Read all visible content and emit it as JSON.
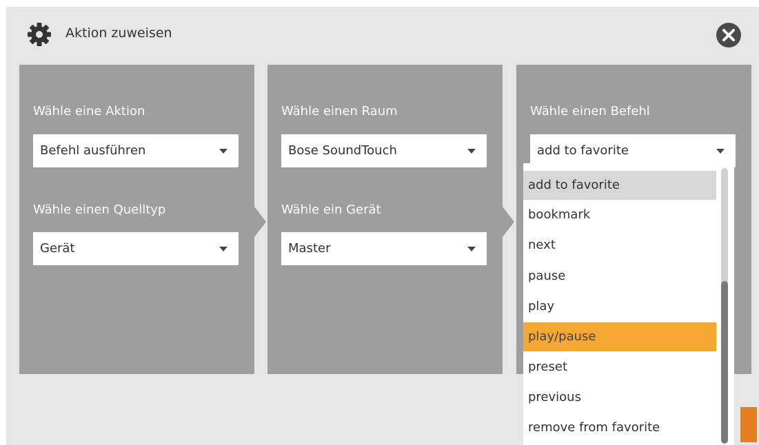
{
  "dialog": {
    "title": "Aktion zuweisen",
    "header_icon": "gear-icon",
    "close_icon": "close-icon"
  },
  "panels": [
    {
      "label1": "Wähle eine Aktion",
      "select1": "Befehl ausführen",
      "label2": "Wähle einen Quelltyp",
      "select2": "Gerät"
    },
    {
      "label1": "Wähle einen Raum",
      "select1": "Bose SoundTouch",
      "label2": "Wähle ein Gerät",
      "select2": "Master"
    },
    {
      "label1": "Wähle einen Befehl",
      "select1": "add to favorite"
    }
  ],
  "dropdown": {
    "items": [
      "add to favorite",
      "bookmark",
      "next",
      "pause",
      "play",
      "play/pause",
      "preset",
      "previous",
      "remove from favorite"
    ],
    "selected": "add to favorite",
    "highlighted": "play/pause"
  },
  "colors": {
    "background": "#e6e6e6",
    "panel": "#9e9e9e",
    "highlight": "#f6a832",
    "accent_button": "#e37e1e",
    "close": "#4a4a4a"
  }
}
